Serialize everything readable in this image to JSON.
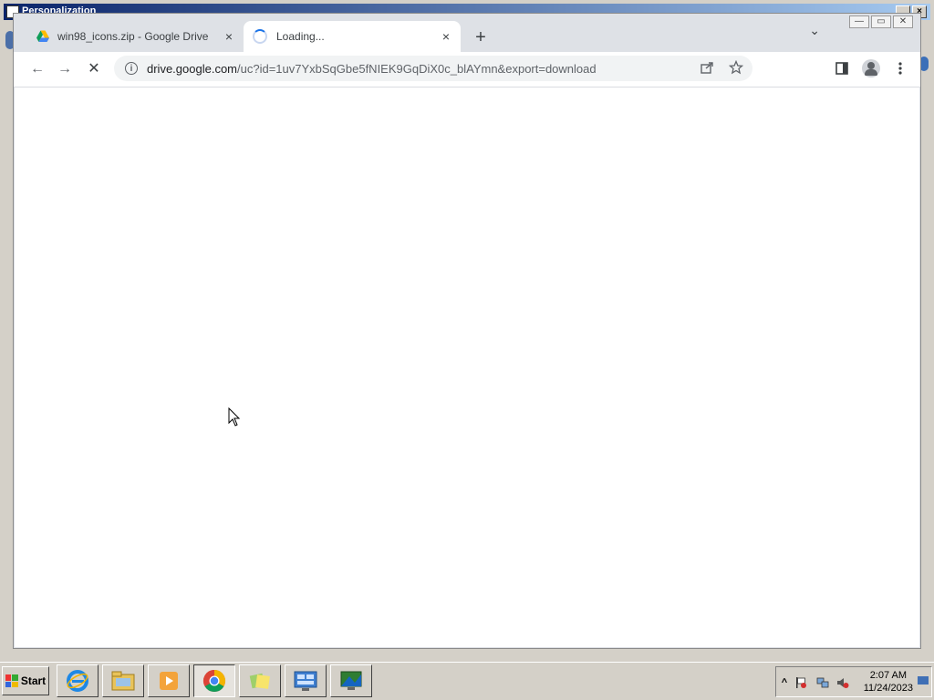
{
  "background_window": {
    "title": "Personalization"
  },
  "browser": {
    "tabs": [
      {
        "title": "win98_icons.zip - Google Drive",
        "close": "×"
      },
      {
        "title": "Loading...",
        "close": "×"
      }
    ],
    "new_tab": "+",
    "tab_search": "⌄",
    "nav": {
      "back": "←",
      "forward": "→",
      "stop": "✕"
    },
    "address": {
      "domain": "drive.google.com",
      "path": "/uc?id=1uv7YxbSqGbe5fNIEK9GqDiX0c_blAYmn&export=download"
    },
    "window_controls": {
      "minimize": "—",
      "maximize": "▭",
      "close": "✕"
    }
  },
  "taskbar": {
    "start_label": "Start",
    "clock_time": "2:07 AM",
    "clock_date": "11/24/2023",
    "tray_chevron": "^"
  },
  "colors": {
    "accent": "#1a73e8",
    "title_bar": "#0a246a"
  }
}
